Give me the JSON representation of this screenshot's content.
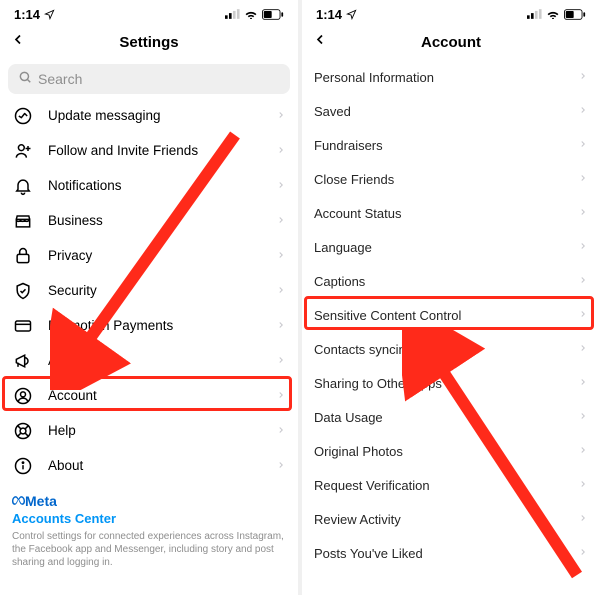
{
  "status": {
    "time": "1:14",
    "location_active": true
  },
  "left": {
    "title": "Settings",
    "search_placeholder": "Search",
    "rows": [
      {
        "icon": "messaging",
        "label": "Update messaging"
      },
      {
        "icon": "invite",
        "label": "Follow and Invite Friends"
      },
      {
        "icon": "bell",
        "label": "Notifications"
      },
      {
        "icon": "business",
        "label": "Business"
      },
      {
        "icon": "lock",
        "label": "Privacy"
      },
      {
        "icon": "shield",
        "label": "Security"
      },
      {
        "icon": "card",
        "label": "Promotion Payments"
      },
      {
        "icon": "ads",
        "label": "Ads"
      },
      {
        "icon": "account",
        "label": "Account"
      },
      {
        "icon": "help",
        "label": "Help"
      },
      {
        "icon": "about",
        "label": "About"
      }
    ],
    "meta": {
      "brand": "Meta",
      "center": "Accounts Center",
      "desc": "Control settings for connected experiences across Instagram, the Facebook app and Messenger, including story and post sharing and logging in."
    },
    "highlight_index": 8
  },
  "right": {
    "title": "Account",
    "rows": [
      {
        "label": "Personal Information"
      },
      {
        "label": "Saved"
      },
      {
        "label": "Fundraisers"
      },
      {
        "label": "Close Friends"
      },
      {
        "label": "Account Status"
      },
      {
        "label": "Language"
      },
      {
        "label": "Captions"
      },
      {
        "label": "Sensitive Content Control"
      },
      {
        "label": "Contacts syncing"
      },
      {
        "label": "Sharing to Other Apps"
      },
      {
        "label": "Data Usage"
      },
      {
        "label": "Original Photos"
      },
      {
        "label": "Request Verification"
      },
      {
        "label": "Review Activity"
      },
      {
        "label": "Posts You've Liked"
      }
    ],
    "highlight_index": 7
  },
  "annotation": {
    "color": "#ff2a1a"
  }
}
